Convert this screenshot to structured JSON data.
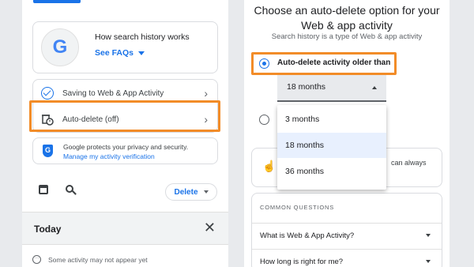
{
  "left": {
    "history_card": {
      "title": "How search history works",
      "link": "See FAQs",
      "logo_letter": "G"
    },
    "settings": [
      {
        "label": "Saving to Web & App Activity",
        "icon": "check-circle-icon"
      },
      {
        "label": "Auto-delete (off)",
        "icon": "auto-delete-icon"
      }
    ],
    "privacy": {
      "text": "Google protects your privacy and security.",
      "link": "Manage my activity verification"
    },
    "toolbar": {
      "delete_label": "Delete"
    },
    "day": {
      "label": "Today"
    },
    "notice": "Some activity may not appear yet"
  },
  "right": {
    "title": "Choose an auto-delete option for your Web & app activity",
    "subtitle": "Search history is a type of Web & app activity",
    "option_label": "Auto-delete activity older than",
    "select_value": "18 months",
    "menu_options": [
      "3 months",
      "18 months",
      "36 months"
    ],
    "selected_option_index": 1,
    "info_text_visible": "can always",
    "faq": {
      "header": "COMMON QUESTIONS",
      "questions": [
        "What is Web & App Activity?",
        "How long is right for me?"
      ]
    }
  },
  "colors": {
    "accent": "#1a73e8",
    "highlight": "#f28c28",
    "background": "#e8eaed"
  }
}
